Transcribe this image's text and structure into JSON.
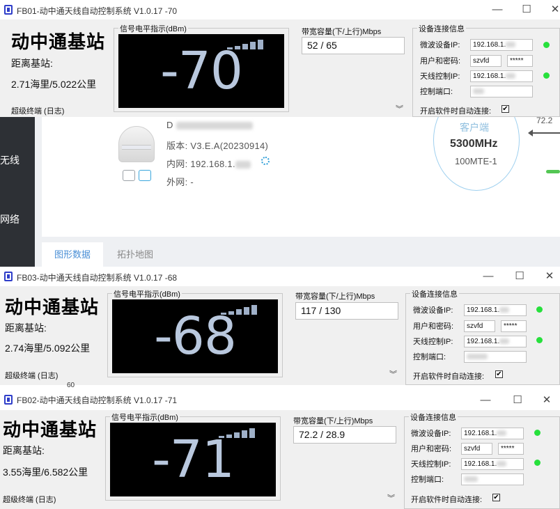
{
  "background": {
    "nav": [
      "无线",
      "网络"
    ],
    "device_name": "D",
    "version_line": "版本: V3.E.A(20230914)",
    "lan_line": "内网: 192.168.1.",
    "wan_line": "外网: -",
    "client_label": "客户端",
    "frequency": "5300MHz",
    "model": "100MTE-1",
    "speed": "72.2",
    "tabs": [
      "图形数据",
      "拓扑地图"
    ],
    "axis_label": "60"
  },
  "windows": [
    {
      "title": "FB01-动中通天线自动控制系统 V1.0.17 -70",
      "station": "动中通基站",
      "dist_label": "距离基站:",
      "dist_value": "2.71海里/5.022公里",
      "terminal": "超级终端 (日志)",
      "signal_label": "信号电平指示(dBm)",
      "signal_value": "-70",
      "bw_label": "带宽容量(下/上行)Mbps",
      "bw_value": "52 / 65",
      "dev_title": "设备连接信息",
      "mw_label": "微波设备IP:",
      "mw_ip": "192.168.1.",
      "user_label": "用户和密码:",
      "user": "szvfd",
      "password": "*****",
      "ant_label": "天线控制IP:",
      "ant_ip": "192.168.1.",
      "port_label": "控制端口:",
      "port": "",
      "auto_label": "开启软件时自动连接:",
      "auto_checked": "✔"
    },
    {
      "title": "FB03-动中通天线自动控制系统 V1.0.17 -68",
      "station": "动中通基站",
      "dist_label": "距离基站:",
      "dist_value": "2.74海里/5.092公里",
      "terminal": "超级终端 (日志)",
      "signal_label": "信号电平指示(dBm)",
      "signal_value": "-68",
      "bw_label": "带宽容量(下/上行)Mbps",
      "bw_value": "117 / 130",
      "dev_title": "设备连接信息",
      "mw_label": "微波设备IP:",
      "mw_ip": "192.168.1.",
      "user_label": "用户和密码:",
      "user": "szvfd",
      "password": "*****",
      "ant_label": "天线控制IP:",
      "ant_ip": "192.168.1.",
      "port_label": "控制端口:",
      "port": "",
      "auto_label": "开启软件时自动连接:",
      "auto_checked": "✔"
    },
    {
      "title": "FB02-动中通天线自动控制系统 V1.0.17 -71",
      "station": "动中通基站",
      "dist_label": "距离基站:",
      "dist_value": "3.55海里/6.582公里",
      "terminal": "超级终端 (日志)",
      "signal_label": "信号电平指示(dBm)",
      "signal_value": "-71",
      "bw_label": "带宽容量(下/上行)Mbps",
      "bw_value": "72.2 / 28.9",
      "dev_title": "设备连接信息",
      "mw_label": "微波设备IP:",
      "mw_ip": "192.168.1.",
      "user_label": "用户和密码:",
      "user": "szvfd",
      "password": "*****",
      "ant_label": "天线控制IP:",
      "ant_ip": "192.168.1.",
      "port_label": "控制端口:",
      "port": "",
      "auto_label": "开启软件时自动连接:",
      "auto_checked": "✔"
    }
  ],
  "window_buttons": {
    "minimize": "—",
    "maximize": "☐",
    "close": "✕"
  },
  "colors": {
    "lcd_bg": "#000000",
    "lcd_text": "#b9c8de",
    "led_green": "#27e03c",
    "title_icon": "#2f3ec9"
  }
}
